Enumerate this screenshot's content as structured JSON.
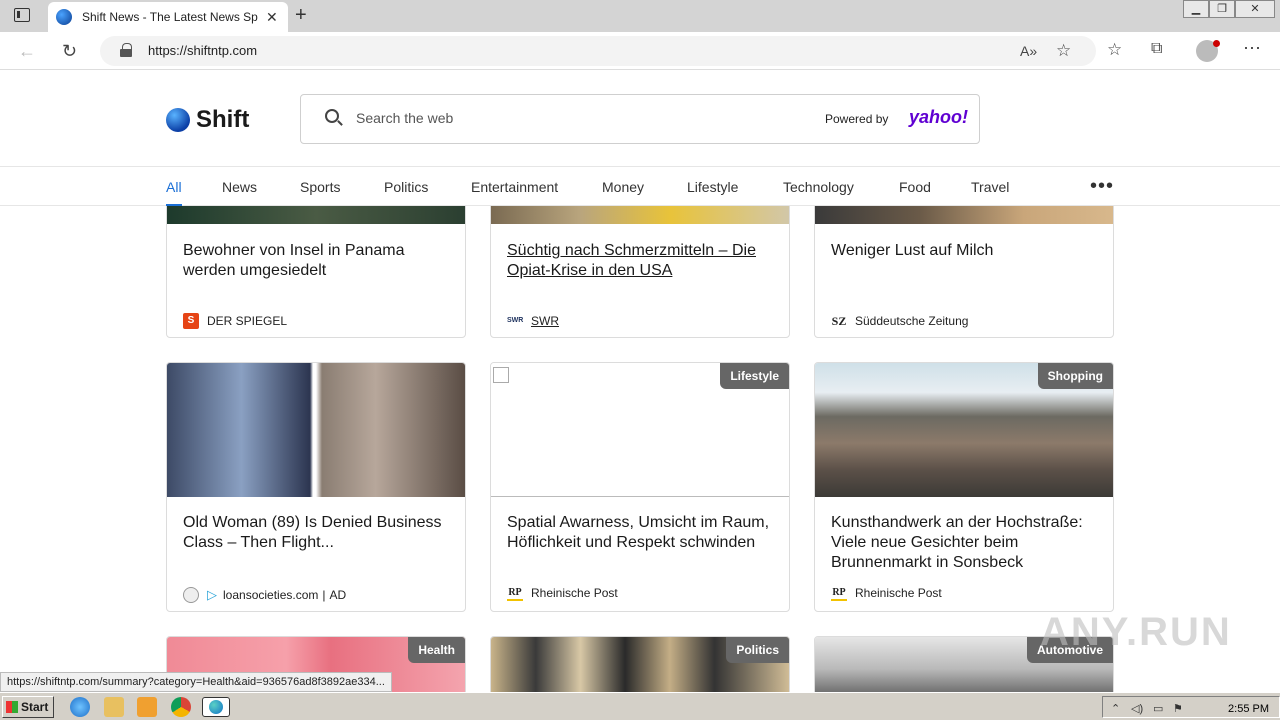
{
  "browser": {
    "tab_title": "Shift News - The Latest News Spo",
    "url": "https://shiftntp.com",
    "status_url": "https://shiftntp.com/summary?category=Health&aid=936576ad8f3892ae334..."
  },
  "header": {
    "logo": "Shift",
    "search_placeholder": "Search the web",
    "powered_by": "Powered by",
    "yahoo": "yahoo!"
  },
  "categories": [
    "All",
    "News",
    "Sports",
    "Politics",
    "Entertainment",
    "Money",
    "Lifestyle",
    "Technology",
    "Food",
    "Travel"
  ],
  "row1": [
    {
      "title": "Bewohner von Insel in Panama werden umgesiedelt",
      "source": "DER SPIEGEL"
    },
    {
      "title": "Süchtig nach Schmerzmitteln – Die Opiat-Krise in den USA",
      "source": "SWR"
    },
    {
      "title": "Weniger Lust auf Milch",
      "source": "Süddeutsche Zeitung"
    }
  ],
  "row2": [
    {
      "title": "Old Woman (89) Is Denied Business Class – Then Flight...",
      "source": "loansocieties.com",
      "ad": "AD"
    },
    {
      "badge": "Lifestyle",
      "title": "Spatial Awarness, Umsicht im Raum, Höflichkeit und Respekt schwinden",
      "source": "Rheinische Post"
    },
    {
      "badge": "Shopping",
      "title": "Kunsthandwerk an der Hochstraße: Viele neue Gesichter beim Brunnenmarkt in Sonsbeck",
      "source": "Rheinische Post"
    }
  ],
  "row3_badges": [
    "Health",
    "Politics",
    "Automotive"
  ],
  "taskbar": {
    "start": "Start",
    "clock": "2:55 PM"
  },
  "watermark": "ANY.RUN",
  "colors": {
    "accent": "#1a6fd6",
    "yahoo": "#6001d2",
    "badge": "#666666"
  }
}
